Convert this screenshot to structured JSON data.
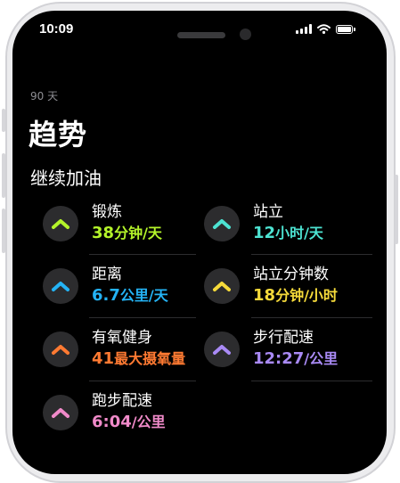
{
  "status_bar": {
    "time": "10:09"
  },
  "header": {
    "range_label": "90 天",
    "title": "趋势",
    "section_title": "继续加油"
  },
  "trends": [
    {
      "label": "锻炼",
      "value": "38",
      "unit": "分钟/天",
      "color": "#b4f42a",
      "icon": "chevron-up-icon"
    },
    {
      "label": "站立",
      "value": "12",
      "unit": "小时/天",
      "color": "#4de3d2",
      "icon": "chevron-up-icon"
    },
    {
      "label": "距离",
      "value": "6.7",
      "unit": "公里/天",
      "color": "#24b3f5",
      "icon": "chevron-up-icon"
    },
    {
      "label": "站立分钟数",
      "value": "18",
      "unit": "分钟/小时",
      "color": "#f5da3a",
      "icon": "chevron-up-icon"
    },
    {
      "label": "有氧健身",
      "value": "41",
      "unit": "最大摄氧量",
      "color": "#ff7a32",
      "icon": "chevron-up-icon"
    },
    {
      "label": "步行配速",
      "value": "12:27",
      "unit": "/公里",
      "color": "#a98af5",
      "icon": "chevron-up-icon"
    },
    {
      "label": "跑步配速",
      "value": "6:04",
      "unit": "/公里",
      "color": "#f08ac9",
      "icon": "chevron-up-icon"
    }
  ]
}
